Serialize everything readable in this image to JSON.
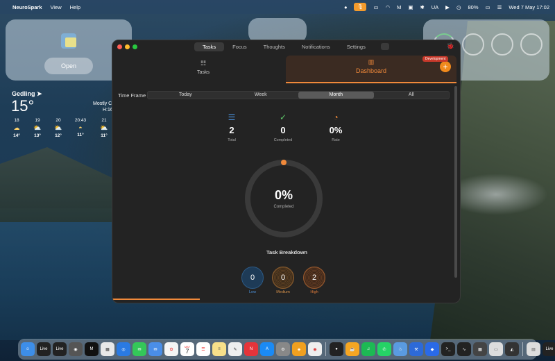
{
  "menubar": {
    "app_name": "NeuroSpark",
    "menus": [
      "View",
      "Help"
    ],
    "battery": "80%",
    "input_source": "UA",
    "datetime": "Wed 7 May  17:02"
  },
  "desktop": {
    "note_widget_button": "Open",
    "weather": {
      "location": "Gedling",
      "temperature": "15°",
      "condition": "Mostly C",
      "hi_lo": "H:16",
      "forecast": [
        {
          "time": "18",
          "temp": "14°"
        },
        {
          "time": "19",
          "temp": "13°"
        },
        {
          "time": "20",
          "temp": "12°"
        },
        {
          "time": "20:43",
          "temp": "11°"
        },
        {
          "time": "21",
          "temp": "11°"
        }
      ]
    }
  },
  "window": {
    "tabs": [
      "Tasks",
      "Focus",
      "Thoughts",
      "Notifications",
      "Settings"
    ],
    "active_tab": "Tasks",
    "nav": {
      "tasks_label": "Tasks",
      "dashboard_label": "Dashboard",
      "dev_badge": "Development"
    },
    "timeframe": {
      "label": "Time Frame",
      "options": [
        "Today",
        "Week",
        "Month",
        "All"
      ],
      "selected": "Month"
    },
    "stats": {
      "total": {
        "value": "2",
        "label": "Total"
      },
      "completed": {
        "value": "0",
        "label": "Completed"
      },
      "rate": {
        "value": "0%",
        "label": "Rate"
      }
    },
    "ring": {
      "percent_text": "0%",
      "label": "Completed",
      "fraction": 0
    },
    "breakdown": {
      "title": "Task Breakdown",
      "low": {
        "value": "0",
        "label": "Low"
      },
      "medium": {
        "value": "0",
        "label": "Medium"
      },
      "high": {
        "value": "2",
        "label": "High"
      }
    }
  },
  "colors": {
    "accent": "#f0893a",
    "low": "#4a90d9",
    "medium": "#d9934a",
    "high": "#e07b3a",
    "completed_icon": "#5fc86a"
  },
  "dock": {
    "live_label": "Live",
    "calendar_month": "MAY",
    "calendar_day": "7"
  }
}
